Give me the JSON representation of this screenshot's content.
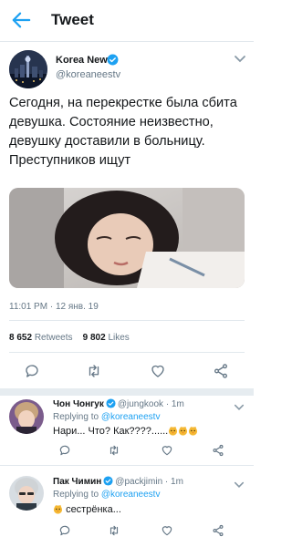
{
  "header": {
    "title": "Tweet",
    "back_icon": "arrow-left-icon"
  },
  "tweet": {
    "author_name": "Korea News",
    "author_handle": "@koreaneestv",
    "text": "Сегодня, на перекрестке была сбита девушка. Состояние неизвестно, девушку доставили в больницу. Преступников ищут",
    "timestamp": "11:01 PM · 12 янв. 19",
    "retweets_count": "8 652",
    "retweets_label": "Retweets",
    "likes_count": "9 802",
    "likes_label": "Likes"
  },
  "replies": [
    {
      "name": "Чон Чонгук",
      "handle": "@jungkook",
      "time": "· 1m",
      "replying_prefix": "Replying to",
      "replying_to": "@koreaneestv",
      "text": "Нари... Что? Как????......",
      "emoji_count": 3
    },
    {
      "name": "Пак Чимин",
      "handle": "@packjimin",
      "time": "· 1m",
      "replying_prefix": "Replying to",
      "replying_to": "@koreaneestv",
      "text": "сестрёнка...",
      "emoji_count": 1
    }
  ],
  "colors": {
    "accent": "#1da1f2",
    "muted": "#657786",
    "text": "#14171a",
    "divider": "#e6ecf0"
  }
}
